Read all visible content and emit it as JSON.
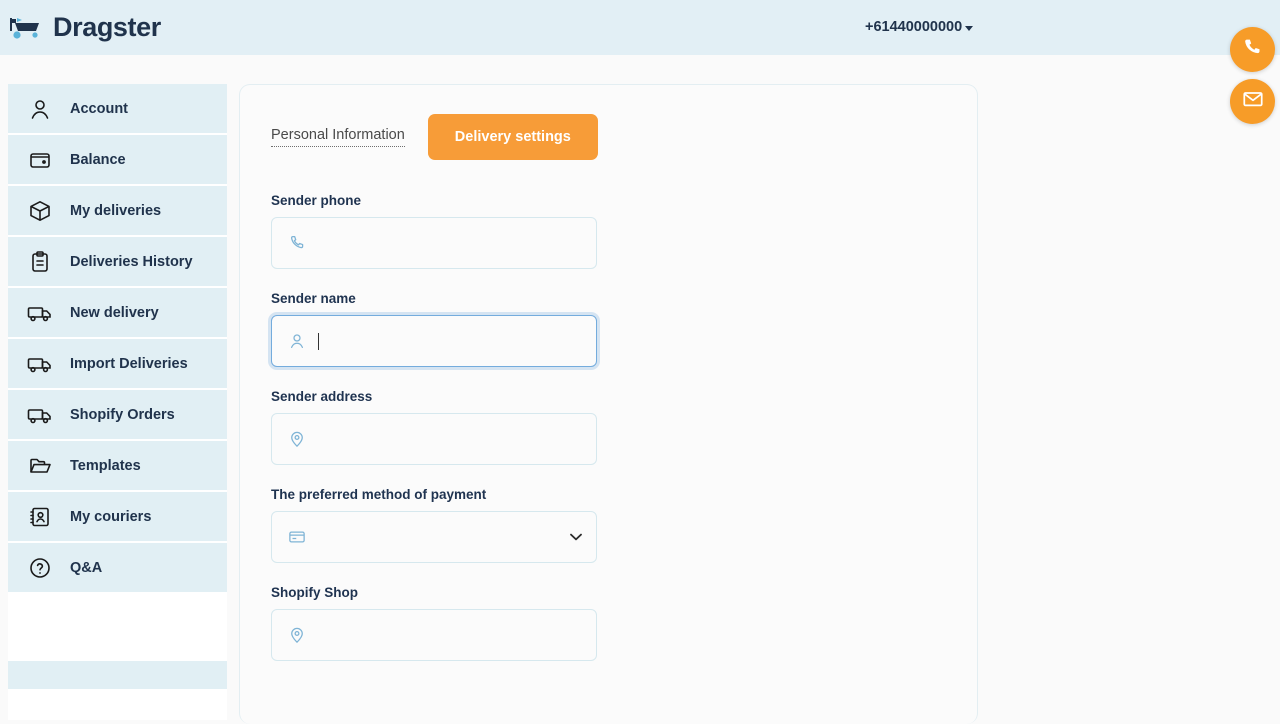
{
  "header": {
    "brand": "Dragster",
    "logo_icon": "shopping-cart-icon",
    "phone": "+61440000000",
    "caret_icon": "caret-down-icon",
    "background_color": "#E2EFF5"
  },
  "sidebar": {
    "items": [
      {
        "label": "Account",
        "icon": "user-icon"
      },
      {
        "label": "Balance",
        "icon": "wallet-icon"
      },
      {
        "label": "My deliveries",
        "icon": "package-icon"
      },
      {
        "label": "Deliveries History",
        "icon": "clipboard-icon"
      },
      {
        "label": "New delivery",
        "icon": "truck-icon"
      },
      {
        "label": "Import Deliveries",
        "icon": "truck-icon"
      },
      {
        "label": "Shopify Orders",
        "icon": "truck-icon"
      },
      {
        "label": "Templates",
        "icon": "folder-icon"
      },
      {
        "label": "My couriers",
        "icon": "contact-book-icon"
      },
      {
        "label": "Q&A",
        "icon": "question-circle-icon"
      }
    ],
    "item_background_color": "#E1EFF4"
  },
  "main": {
    "tabs": [
      {
        "label": "Personal Information",
        "active": false
      },
      {
        "label": "Delivery settings",
        "active": true
      }
    ],
    "accent_color": "#F79C38",
    "fields": [
      {
        "label": "Sender phone",
        "icon": "phone-icon",
        "value": "",
        "placeholder": "",
        "type": "text",
        "focused": false
      },
      {
        "label": "Sender name",
        "icon": "user-icon",
        "value": "",
        "placeholder": "",
        "type": "text",
        "focused": true
      },
      {
        "label": "Sender address",
        "icon": "location-pin-icon",
        "value": "",
        "placeholder": "",
        "type": "text",
        "focused": false
      },
      {
        "label": "The preferred method of payment",
        "icon": "credit-card-icon",
        "value": "",
        "placeholder": "",
        "type": "select",
        "focused": false
      },
      {
        "label": "Shopify Shop",
        "icon": "location-pin-icon",
        "value": "",
        "placeholder": "",
        "type": "text",
        "focused": false
      }
    ]
  },
  "floating_actions": [
    {
      "name": "call-button",
      "icon": "phone-icon"
    },
    {
      "name": "email-button",
      "icon": "envelope-icon"
    }
  ]
}
